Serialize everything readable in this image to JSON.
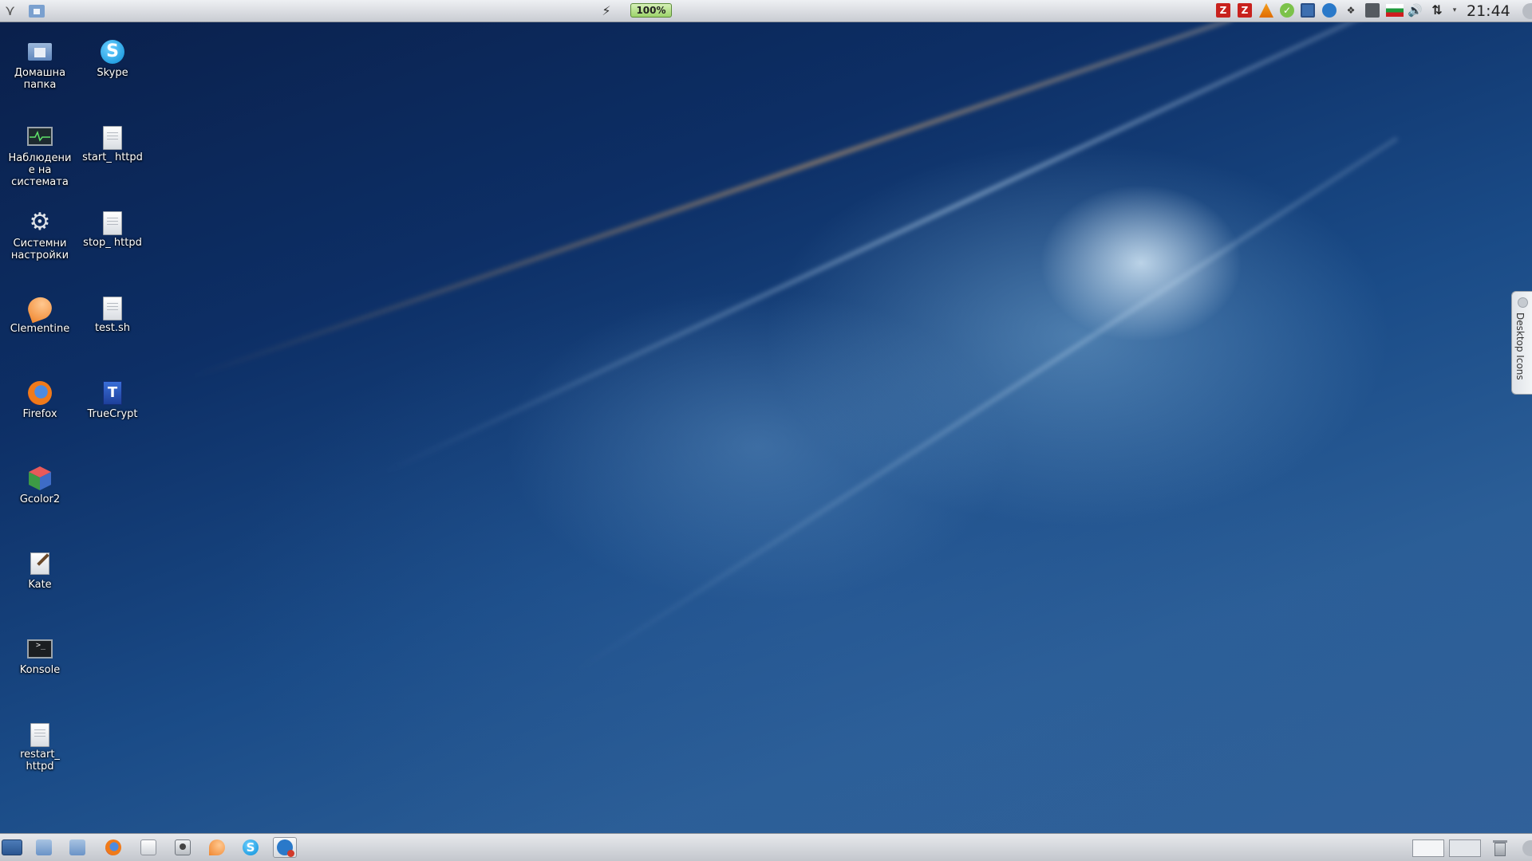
{
  "top_panel": {
    "battery_percent": "100%",
    "clock": "21:44",
    "tray_icons": [
      "filezilla-icon",
      "filezilla-icon",
      "vlc-icon",
      "update-icon",
      "clipboard-window-icon",
      "network-share-icon",
      "dropbox-icon",
      "klipper-icon",
      "bulgarian-flag-icon",
      "volume-icon",
      "network-icon"
    ]
  },
  "desktop": {
    "icons": [
      {
        "name": "home-folder",
        "label": "Домашна папка",
        "icon": "home-folder-icon"
      },
      {
        "name": "skype",
        "label": "Skype",
        "icon": "skype-icon"
      },
      {
        "name": "system-monitor",
        "label": "Наблюдение на системата",
        "icon": "system-monitor-icon"
      },
      {
        "name": "start-httpd",
        "label": "start_ httpd",
        "icon": "document-icon"
      },
      {
        "name": "system-settings",
        "label": "Системни настройки",
        "icon": "gear-icon"
      },
      {
        "name": "stop-httpd",
        "label": "stop_ httpd",
        "icon": "document-icon"
      },
      {
        "name": "clementine",
        "label": "Clementine",
        "icon": "clementine-icon"
      },
      {
        "name": "test-sh",
        "label": "test.sh",
        "icon": "document-icon"
      },
      {
        "name": "firefox",
        "label": "Firefox",
        "icon": "firefox-icon"
      },
      {
        "name": "truecrypt",
        "label": "TrueCrypt",
        "icon": "truecrypt-icon"
      },
      {
        "name": "gcolor2",
        "label": "Gcolor2",
        "icon": "cube-icon"
      },
      {
        "name": "kate",
        "label": "Kate",
        "icon": "text-editor-icon"
      },
      {
        "name": "konsole",
        "label": "Konsole",
        "icon": "terminal-icon"
      },
      {
        "name": "restart-httpd",
        "label": "restart_ httpd",
        "icon": "document-icon"
      }
    ],
    "widget_label": "Desktop Icons"
  },
  "taskbar": {
    "items": [
      "show-desktop-icon",
      "file-manager-icon",
      "file-manager-icon",
      "firefox-icon",
      "kate-icon",
      "screenshot-icon",
      "clementine-icon",
      "skype-icon",
      "network-tool-icon"
    ]
  }
}
